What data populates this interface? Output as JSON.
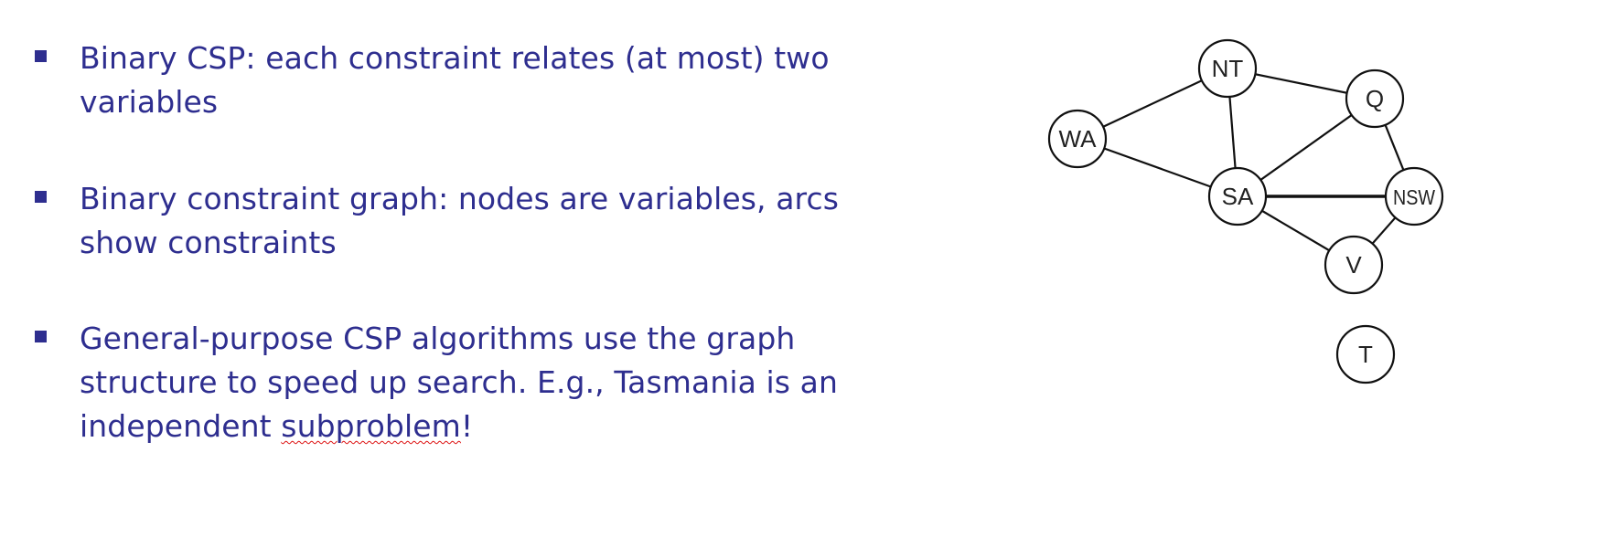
{
  "bullets": [
    {
      "lines": [
        "Binary CSP: each constraint relates (at most) two",
        "variables"
      ]
    },
    {
      "lines": [
        "Binary constraint graph: nodes are variables, arcs",
        "show constraints"
      ]
    },
    {
      "lines": [
        "General-purpose CSP algorithms use the graph",
        "structure to speed up search. E.g., Tasmania is an"
      ],
      "last_line_prefix": "independent ",
      "last_line_flagged_word": "subproblem",
      "last_line_suffix": "!"
    }
  ],
  "graph": {
    "nodes": [
      {
        "id": "WA",
        "label": "WA"
      },
      {
        "id": "NT",
        "label": "NT"
      },
      {
        "id": "Q",
        "label": "Q"
      },
      {
        "id": "SA",
        "label": "SA"
      },
      {
        "id": "NSW",
        "label": "NSW"
      },
      {
        "id": "V",
        "label": "V"
      },
      {
        "id": "T",
        "label": "T"
      }
    ],
    "edges": [
      [
        "WA",
        "NT"
      ],
      [
        "WA",
        "SA"
      ],
      [
        "NT",
        "Q"
      ],
      [
        "NT",
        "SA"
      ],
      [
        "Q",
        "SA"
      ],
      [
        "Q",
        "NSW"
      ],
      [
        "SA",
        "NSW"
      ],
      [
        "SA",
        "V"
      ],
      [
        "NSW",
        "V"
      ]
    ]
  },
  "colors": {
    "text": "#2e2e8f",
    "bullet": "#2e2e8f",
    "graph_stroke": "#111111",
    "spellcheck_underline": "#dd1111"
  }
}
